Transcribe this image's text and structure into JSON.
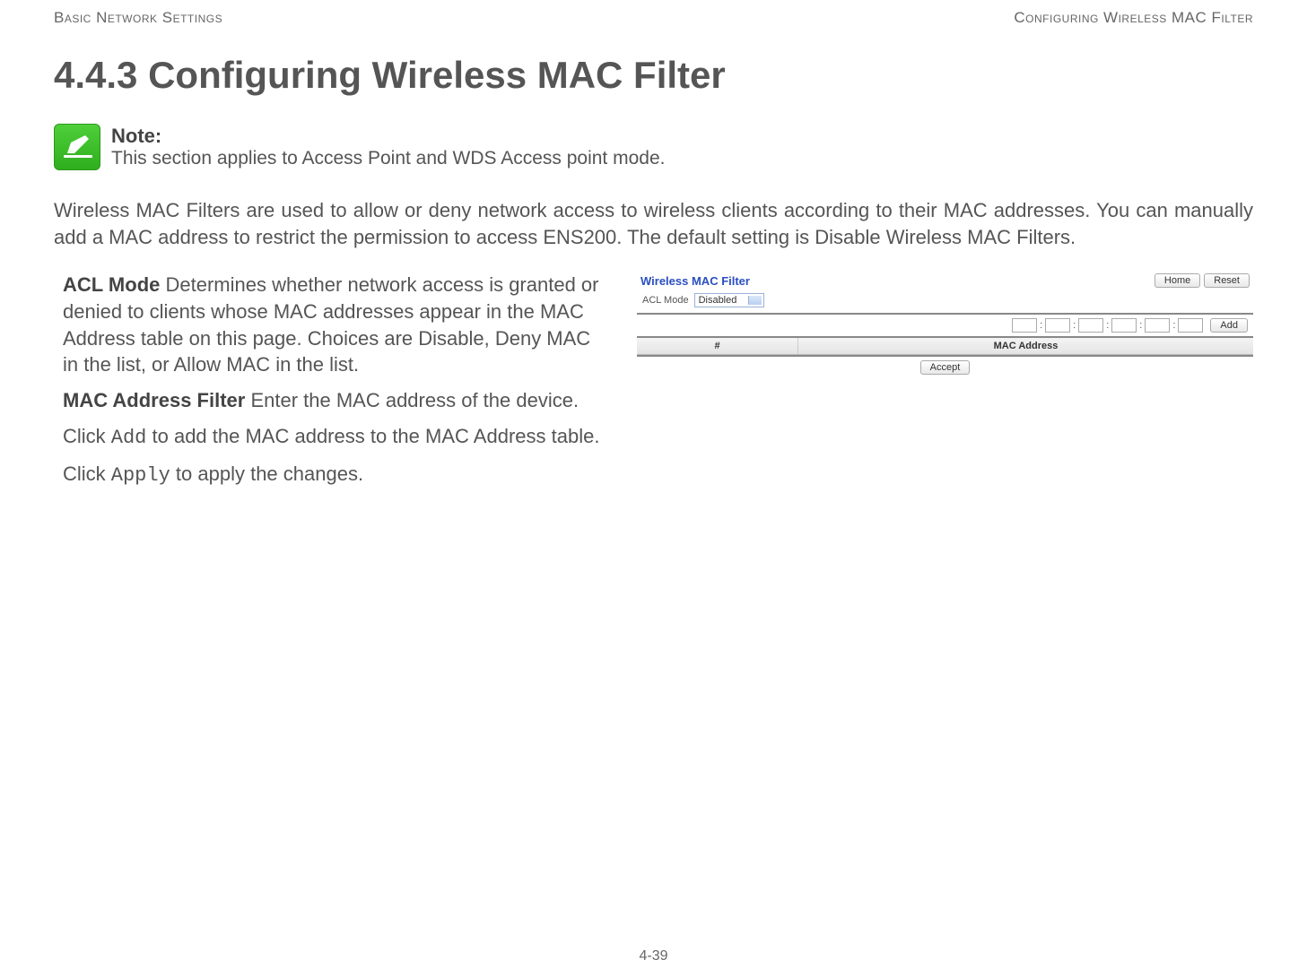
{
  "header": {
    "left": "Basic Network Settings",
    "right": "Configuring Wireless MAC Filter"
  },
  "section_title": "4.4.3 Configuring Wireless MAC Filter",
  "note": {
    "label": "Note:",
    "text": "This section applies to Access Point and WDS Access point mode."
  },
  "intro": "Wireless MAC Filters are used to allow or deny network access to wireless clients according to their MAC addresses. You can manually add a MAC address to restrict the permission to access ENS200. The default setting is Disable Wireless MAC Filters.",
  "defs": {
    "acl_term": "ACL Mode",
    "acl_desc": "  Determines whether network access is granted or denied to clients whose MAC addresses appear in the MAC Address table on this page. Choices are Disable, Deny MAC in the list, or Allow MAC in the list.",
    "macf_term": "MAC Address Filter",
    "macf_desc": "  Enter the MAC address of the device.",
    "add_pre": "Click ",
    "add_btn": "Add",
    "add_post": " to add the MAC address to the MAC Address table.",
    "apply_pre": "Click ",
    "apply_btn": "Apply",
    "apply_post": " to apply the changes."
  },
  "ui": {
    "panel_title": "Wireless MAC Filter",
    "home_btn": "Home",
    "reset_btn": "Reset",
    "acl_label": "ACL Mode",
    "acl_value": "Disabled",
    "add_btn": "Add",
    "col_num": "#",
    "col_mac": "MAC Address",
    "accept_btn": "Accept"
  },
  "page_number": "4-39"
}
